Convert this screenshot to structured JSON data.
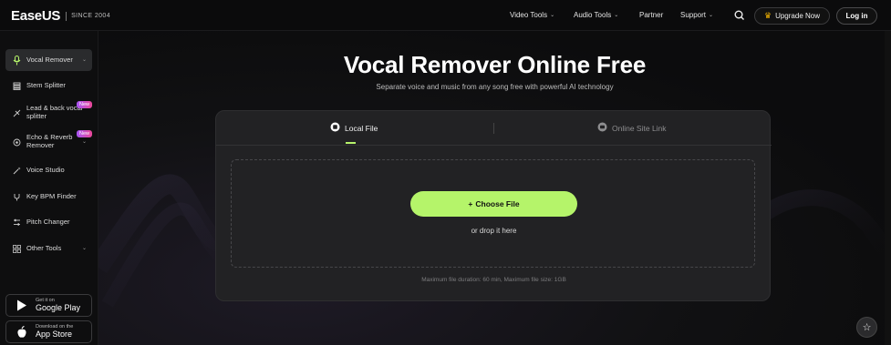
{
  "brand": {
    "logo": "EaseUS",
    "since": "SINCE 2004"
  },
  "nav": {
    "items": [
      {
        "label": "Video Tools",
        "caret": true
      },
      {
        "label": "Audio Tools",
        "caret": true
      },
      {
        "label": "Partner",
        "caret": false
      },
      {
        "label": "Support",
        "caret": true
      }
    ],
    "search_icon": "search-icon",
    "upgrade": "Upgrade Now",
    "login": "Log in"
  },
  "sidebar": {
    "items": [
      {
        "label": "Vocal Remover",
        "icon": "microphone-icon",
        "active": true,
        "caret": true
      },
      {
        "label": "Stem Splitter",
        "icon": "stack-icon"
      },
      {
        "label": "Lead & back vocal splitter",
        "icon": "split-icon",
        "badge": "New"
      },
      {
        "label": "Echo & Reverb Remover",
        "icon": "echo-icon",
        "badge": "New",
        "caret": true
      },
      {
        "label": "Voice Studio",
        "icon": "magic-icon"
      },
      {
        "label": "Key BPM Finder",
        "icon": "tuning-fork-icon"
      },
      {
        "label": "Pitch Changer",
        "icon": "sliders-icon"
      },
      {
        "label": "Other Tools",
        "icon": "grid-icon",
        "caret": true
      }
    ],
    "google_play": {
      "small": "Get it on",
      "big": "Google Play"
    },
    "app_store": {
      "small": "Download on the",
      "big": "App Store"
    }
  },
  "main": {
    "title": "Vocal Remover Online Free",
    "subtitle": "Separate voice and music from any song free with powerful AI technology",
    "tabs": [
      {
        "label": "Local File",
        "active": true
      },
      {
        "label": "Online Site Link",
        "active": false
      }
    ],
    "choose_button": "Choose File",
    "drop_text": "or drop it here",
    "limits": "Maximum file duration: 60 min, Maximum file size: 1GB"
  },
  "colors": {
    "accent": "#b5f46a",
    "badge": "#c04de0",
    "background": "#0b0b0c"
  }
}
